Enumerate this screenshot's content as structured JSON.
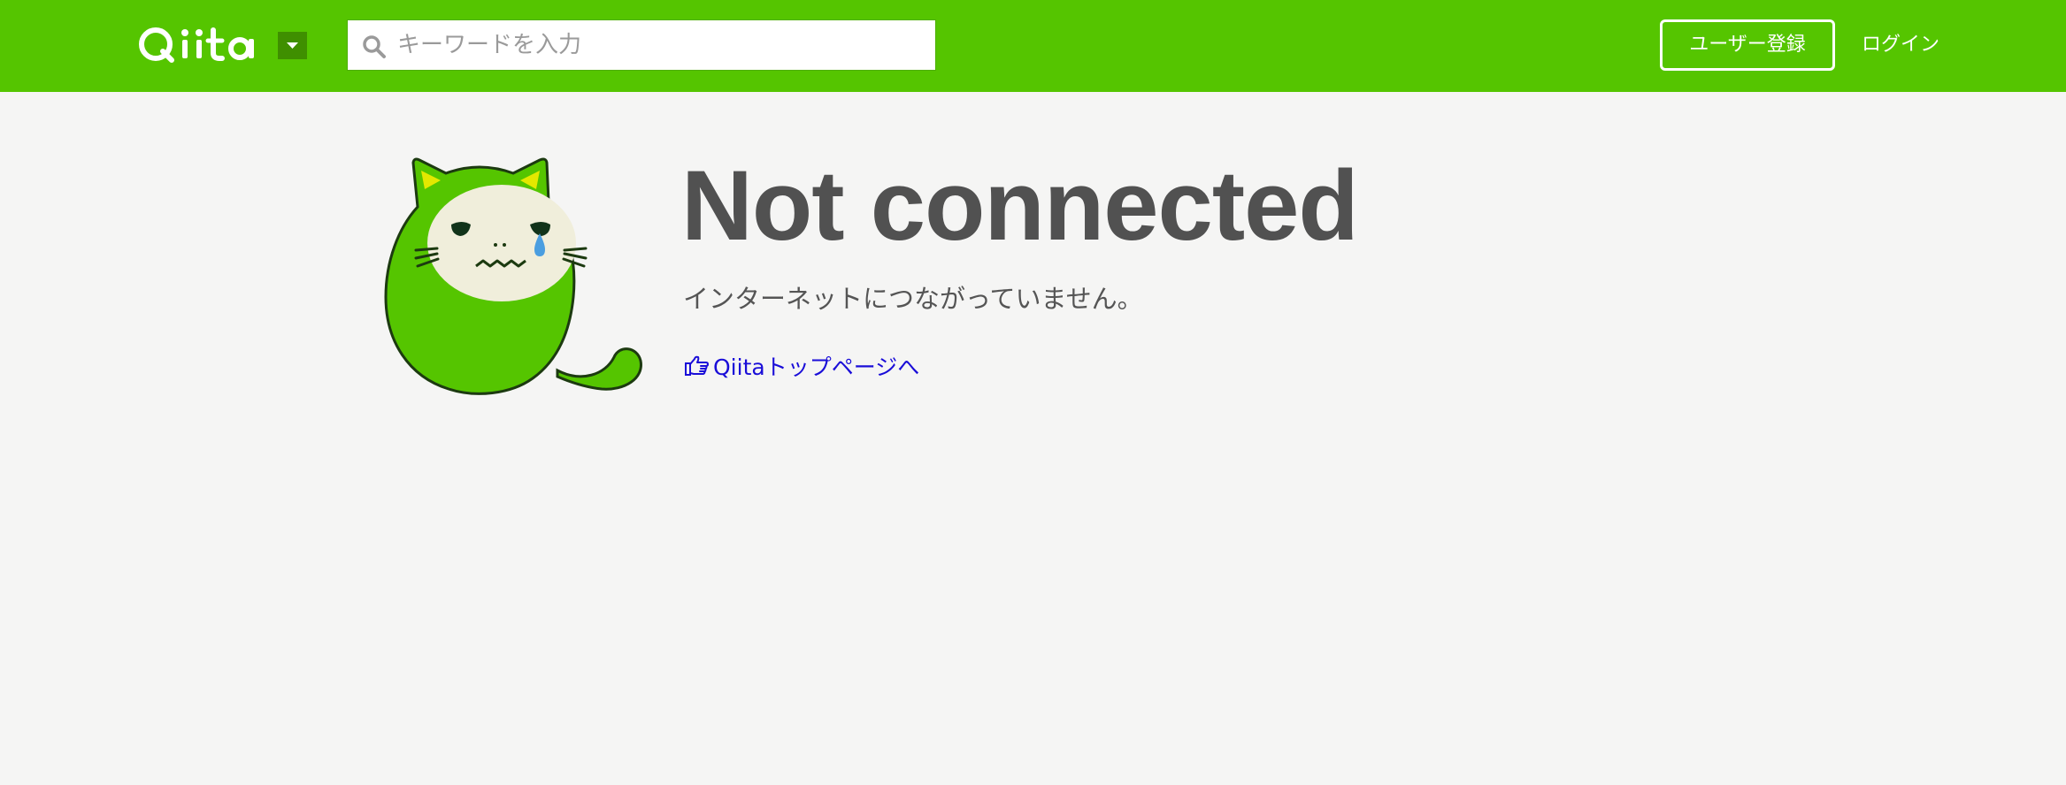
{
  "header": {
    "logo_text": "Qiita",
    "search": {
      "placeholder": "キーワードを入力",
      "value": ""
    },
    "signup_label": "ユーザー登録",
    "login_label": "ログイン"
  },
  "main": {
    "title": "Not connected",
    "subtitle": "インターネットにつながっていません。",
    "home_link": "Qiitaトップページへ"
  },
  "icons": {
    "logo": "qiita-logo",
    "dropdown": "caret-down-icon",
    "search": "search-icon",
    "link": "pointing-hand-icon",
    "illustration": "crying-cat-mascot"
  },
  "colors": {
    "brand": "#55c500",
    "dropdown_bg": "#3f8f00",
    "page_bg": "#f5f5f4",
    "heading": "#515151",
    "text": "#555555",
    "link": "#1a0dd8",
    "tear": "#4a9ee0"
  }
}
